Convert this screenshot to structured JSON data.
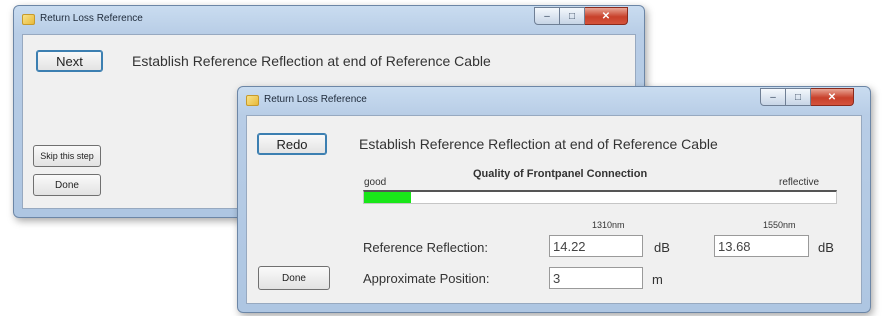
{
  "back_window": {
    "title": "Return Loss Reference",
    "next_button": "Next",
    "instruction": "Establish Reference Reflection at end of Reference Cable",
    "skip_button": "Skip this step",
    "done_button": "Done"
  },
  "front_window": {
    "title": "Return Loss Reference",
    "redo_button": "Redo",
    "instruction": "Establish Reference Reflection at end of Reference Cable",
    "quality": {
      "title": "Quality of Frontpanel Connection",
      "left_label": "good",
      "right_label": "reflective",
      "level": 0.1,
      "fill_color": "#19e619"
    },
    "wavelength_1": "1310nm",
    "wavelength_2": "1550nm",
    "reference_reflection_label": "Reference Reflection:",
    "reflection_1310": "14.22",
    "reflection_1550": "13.68",
    "unit_db": "dB",
    "approximate_position_label": "Approximate Position:",
    "approximate_position": "3",
    "unit_m": "m",
    "done_button": "Done"
  },
  "caption_icons": [
    "minimize-icon",
    "maximize-icon",
    "close-icon"
  ]
}
